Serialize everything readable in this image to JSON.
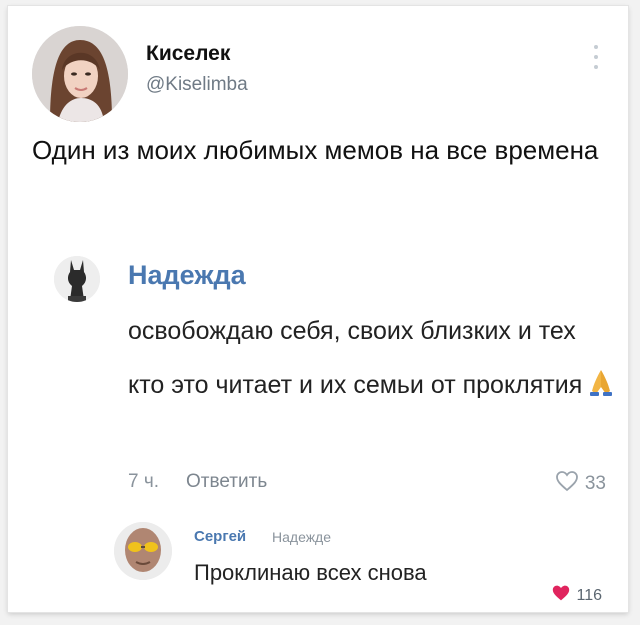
{
  "author": {
    "name": "Киселек",
    "handle": "@Kiselimba"
  },
  "tweet": {
    "text": "Один из моих любимых мемов на все времена"
  },
  "comment": {
    "name": "Надежда",
    "text": "освобождаю себя, своих близких и тех кто это читает и их семьи от проклятия",
    "emoji": "folded-hands",
    "time": "7 ч.",
    "reply_label": "Ответить",
    "likes": "33"
  },
  "reply": {
    "name": "Сергей",
    "to": "Надежде",
    "text": "Проклинаю всех снова",
    "likes": "116",
    "heart_color": "#e0245e"
  },
  "icons": [
    "more-icon",
    "heart-outline-icon",
    "heart-filled-icon",
    "folded-hands-icon"
  ],
  "colors": {
    "name_link": "#4a78b0",
    "muted": "#8a939c",
    "handle": "#6f7a85"
  }
}
